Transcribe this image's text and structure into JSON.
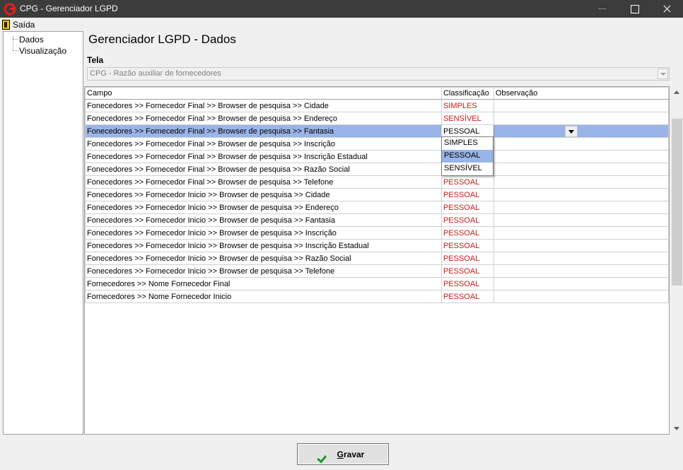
{
  "window": {
    "title": "CPG - Gerenciador LGPD"
  },
  "menu": {
    "exit_label": "Saída"
  },
  "sidebar": {
    "items": [
      {
        "label": "Dados"
      },
      {
        "label": "Visualização"
      }
    ]
  },
  "main": {
    "heading": "Gerenciador LGPD - Dados",
    "tela_label": "Tela",
    "tela_value": "CPG - Razão auxiliar de fornecedores"
  },
  "grid": {
    "columns": [
      "Campo",
      "Classificação",
      "Observação"
    ],
    "rows": [
      {
        "campo": "Fonecedores >> Fornecedor  Final >> Browser de pesquisa >> Cidade",
        "classificacao": "SIMPLES",
        "observacao": ""
      },
      {
        "campo": "Fonecedores >> Fornecedor  Final >> Browser de pesquisa >> Endereço",
        "classificacao": "SENSÍVEL",
        "observacao": ""
      },
      {
        "campo": "Fonecedores >> Fornecedor  Final >> Browser de pesquisa >> Fantasia",
        "classificacao": "PESSOAL",
        "observacao": "",
        "selected": true
      },
      {
        "campo": "Fonecedores >> Fornecedor  Final >> Browser de pesquisa >> Inscrição",
        "classificacao": "",
        "observacao": ""
      },
      {
        "campo": "Fonecedores >> Fornecedor  Final >> Browser de pesquisa >> Inscrição Estadual",
        "classificacao": "",
        "observacao": ""
      },
      {
        "campo": "Fonecedores >> Fornecedor  Final >> Browser de pesquisa >> Razão Social",
        "classificacao": "",
        "observacao": ""
      },
      {
        "campo": "Fonecedores >> Fornecedor  Final >> Browser de pesquisa >> Telefone",
        "classificacao": "PESSOAL",
        "observacao": ""
      },
      {
        "campo": "Fonecedores >> Fornecedor  Inicio >> Browser de pesquisa >> Cidade",
        "classificacao": "PESSOAL",
        "observacao": ""
      },
      {
        "campo": "Fonecedores >> Fornecedor  Inicio >> Browser de pesquisa >> Endereço",
        "classificacao": "PESSOAL",
        "observacao": ""
      },
      {
        "campo": "Fonecedores >> Fornecedor  Inicio >> Browser de pesquisa >> Fantasia",
        "classificacao": "PESSOAL",
        "observacao": ""
      },
      {
        "campo": "Fonecedores >> Fornecedor  Inicio >> Browser de pesquisa >> Inscrição",
        "classificacao": "PESSOAL",
        "observacao": ""
      },
      {
        "campo": "Fonecedores >> Fornecedor  Inicio >> Browser de pesquisa >> Inscrição Estadual",
        "classificacao": "PESSOAL",
        "observacao": ""
      },
      {
        "campo": "Fonecedores >> Fornecedor  Inicio >> Browser de pesquisa >> Razão Social",
        "classificacao": "PESSOAL",
        "observacao": ""
      },
      {
        "campo": "Fonecedores >> Fornecedor  Inicio >> Browser de pesquisa >> Telefone",
        "classificacao": "PESSOAL",
        "observacao": ""
      },
      {
        "campo": "Fornecedores >> Nome Fornecedor Final",
        "classificacao": "PESSOAL",
        "observacao": ""
      },
      {
        "campo": "Fornecedores >> Nome Fornecedor Inicio",
        "classificacao": "PESSOAL",
        "observacao": ""
      }
    ]
  },
  "dropdown": {
    "options": [
      "SIMPLES",
      "PESSOAL",
      "SENSÍVEL"
    ],
    "selected": "PESSOAL"
  },
  "footer": {
    "save_label": "Gravar",
    "save_mnemonic": "G",
    "save_rest": "ravar"
  },
  "colors": {
    "classification_text": "#d01818",
    "selection": "#99b4e8",
    "titlebar": "#3c3c3c",
    "check_icon": "#1a9a2a"
  }
}
